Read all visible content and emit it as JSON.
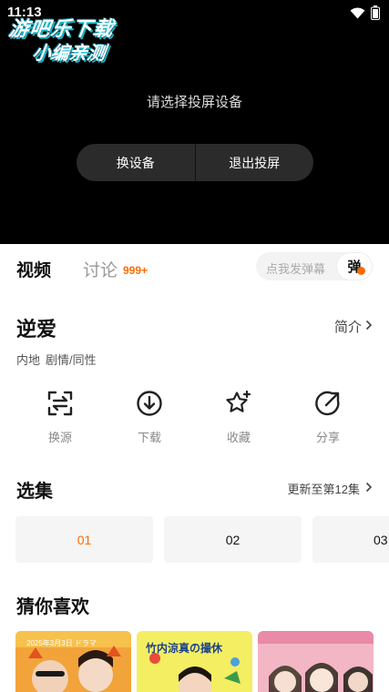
{
  "status_bar": {
    "time": "11:13",
    "icons": [
      "wifi-icon",
      "battery-icon"
    ]
  },
  "watermark": {
    "line1": "游吧乐下载",
    "line2": "小编亲测"
  },
  "player": {
    "cast_prompt": "请选择投屏设备",
    "change_device_label": "换设备",
    "exit_cast_label": "退出投屏"
  },
  "tabs": {
    "video_label": "视频",
    "discuss_label": "讨论",
    "discuss_count": "999+",
    "danmu_placeholder": "点我发弹幕",
    "danmu_toggle_label": "弹"
  },
  "show": {
    "title": "逆爱",
    "intro_label": "简介",
    "tags": [
      "内地",
      "剧情/同性"
    ]
  },
  "actions": [
    {
      "label": "换源",
      "icon": "switch-source-icon"
    },
    {
      "label": "下载",
      "icon": "download-icon"
    },
    {
      "label": "收藏",
      "icon": "favorite-star-icon"
    },
    {
      "label": "分享",
      "icon": "share-icon"
    }
  ],
  "episodes": {
    "title": "选集",
    "update_status": "更新至第12集",
    "items": [
      "01",
      "02",
      "03"
    ],
    "active_index": 0
  },
  "recommend": {
    "title": "猜你喜欢",
    "posters": [
      {
        "caption": "2025年3月3日 ドラマ"
      },
      {
        "caption": "竹内涼真の撮休"
      },
      {
        "caption": ""
      }
    ]
  },
  "colors": {
    "accent": "#ff6a00",
    "player_bg": "#000000",
    "cast_button_bg": "#2b2b2b"
  }
}
